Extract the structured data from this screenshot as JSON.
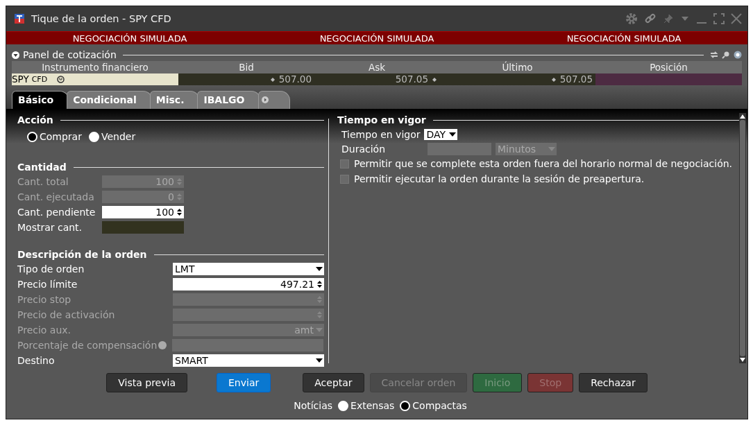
{
  "window": {
    "title": "Tique de la orden - SPY CFD"
  },
  "banner": [
    "NEGOCIACIÓN SIMULADA",
    "NEGOCIACIÓN SIMULADA",
    "NEGOCIACIÓN SIMULADA"
  ],
  "quote_panel": {
    "title": "Panel de cotización",
    "expanded": true,
    "columns": [
      "Instrumento financiero",
      "Bid",
      "Ask",
      "Último",
      "Posición"
    ],
    "row": {
      "symbol": "SPY",
      "type": "CFD",
      "bid": "507.00",
      "ask": "507.05",
      "last": "507.05"
    }
  },
  "tabs": [
    {
      "label": "Básico",
      "selected": true
    },
    {
      "label": "Condicional",
      "selected": false
    },
    {
      "label": "Misc.",
      "selected": false
    },
    {
      "label": "IBALGO",
      "selected": false
    }
  ],
  "accion": {
    "title": "Acción",
    "options": [
      {
        "label": "Comprar",
        "selected": true
      },
      {
        "label": "Vender",
        "selected": false
      }
    ]
  },
  "cantidad": {
    "title": "Cantidad",
    "fields": [
      {
        "label": "Cant. total",
        "value": "100",
        "disabled": true,
        "kind": "spin"
      },
      {
        "label": "Cant. ejecutada",
        "value": "0",
        "disabled": true,
        "kind": "spin"
      },
      {
        "label": "Cant. pendiente",
        "value": "100",
        "disabled": false,
        "kind": "spin"
      },
      {
        "label": "Mostrar cant.",
        "disabled": false,
        "kind": "dark"
      }
    ]
  },
  "descripcion": {
    "title": "Descripción de la orden",
    "fields": [
      {
        "label": "Tipo de orden",
        "value": "LMT",
        "disabled": false,
        "kind": "select"
      },
      {
        "label": "Precio límite",
        "value": "497.21",
        "disabled": false,
        "kind": "spin"
      },
      {
        "label": "Precio stop",
        "disabled": true,
        "kind": "spin"
      },
      {
        "label": "Precio de activación",
        "disabled": true,
        "kind": "spin"
      },
      {
        "label": "Precio aux.",
        "value": "amt",
        "disabled": true,
        "kind": "select"
      },
      {
        "label": "Porcentaje de compensación",
        "disabled": true,
        "kind": "text"
      },
      {
        "label": "Destino",
        "value": "SMART",
        "disabled": false,
        "kind": "select"
      }
    ]
  },
  "tiempo": {
    "title": "Tiempo en vigor",
    "tif_label": "Tiempo en vigor",
    "tif_value": "DAY",
    "duration_label": "Duración",
    "duration_unit": "Minutos",
    "checks": [
      {
        "label": "Permitir que se complete esta orden fuera del horario normal de negociación.",
        "checked": false
      },
      {
        "label": "Permitir ejecutar la orden durante la sesión de preapertura.",
        "checked": false
      }
    ]
  },
  "buttons": [
    {
      "label": "Vista previa",
      "kind": "default",
      "disabled": false
    },
    {
      "label": "Enviar",
      "kind": "primary",
      "disabled": false
    },
    {
      "label": "Aceptar",
      "kind": "default",
      "disabled": false
    },
    {
      "label": "Cancelar orden",
      "kind": "default",
      "disabled": true
    },
    {
      "label": "Inicio",
      "kind": "start",
      "disabled": true
    },
    {
      "label": "Stop",
      "kind": "stop",
      "disabled": true
    },
    {
      "label": "Rechazar",
      "kind": "default",
      "disabled": false
    }
  ],
  "news": {
    "label": "Notícias",
    "options": [
      {
        "label": "Extensas",
        "selected": false
      },
      {
        "label": "Compactas",
        "selected": true
      }
    ]
  }
}
